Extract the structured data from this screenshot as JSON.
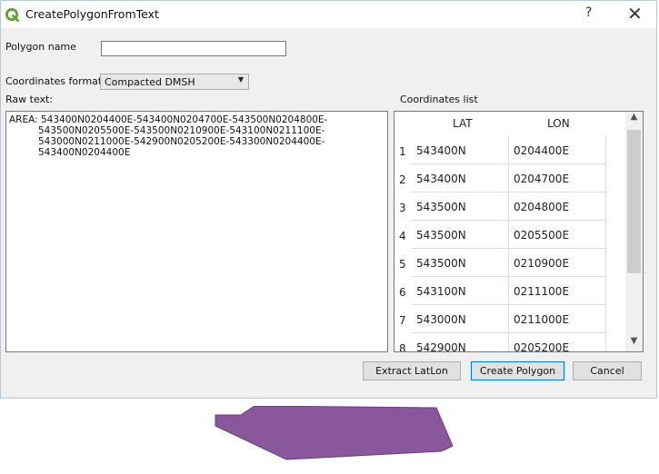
{
  "window": {
    "title": "CreatePolygonFromText",
    "help": "?",
    "close": "✕"
  },
  "form": {
    "polygon_name_label": "Polygon name",
    "polygon_name_value": "",
    "coords_format_label": "Coordinates format:",
    "coords_format_value": "Compacted DMSH",
    "raw_text_label": "Raw text:",
    "coords_list_label": "Coordinates list"
  },
  "raw_text": [
    "AREA: 543400N0204400E-543400N0204700E-543500N0204800E-",
    "543500N0205500E-543500N0210900E-543100N0211100E-",
    "543000N0211000E-542900N0205200E-543300N0204400E-",
    "543400N0204400E"
  ],
  "table": {
    "headers": [
      "LAT",
      "LON"
    ],
    "rows": [
      {
        "n": "1",
        "lat": "543400N",
        "lon": "0204400E"
      },
      {
        "n": "2",
        "lat": "543400N",
        "lon": "0204700E"
      },
      {
        "n": "3",
        "lat": "543500N",
        "lon": "0204800E"
      },
      {
        "n": "4",
        "lat": "543500N",
        "lon": "0205500E"
      },
      {
        "n": "5",
        "lat": "543500N",
        "lon": "0210900E"
      },
      {
        "n": "6",
        "lat": "543100N",
        "lon": "0211100E"
      },
      {
        "n": "7",
        "lat": "543000N",
        "lon": "0211000E"
      },
      {
        "n": "8",
        "lat": "542900N",
        "lon": "0205200E"
      }
    ]
  },
  "buttons": {
    "extract": "Extract LatLon",
    "create": "Create Polygon",
    "cancel": "Cancel"
  },
  "colors": {
    "app_icon": "#5fa233",
    "polygon_fill": "#8b579c",
    "polygon_stroke": "#6a3f78"
  },
  "icons": {
    "app": "qgis-logo-icon",
    "dropdown": "chevron-down-icon",
    "scroll_up": "chevron-up-icon",
    "scroll_down": "chevron-down-icon"
  }
}
